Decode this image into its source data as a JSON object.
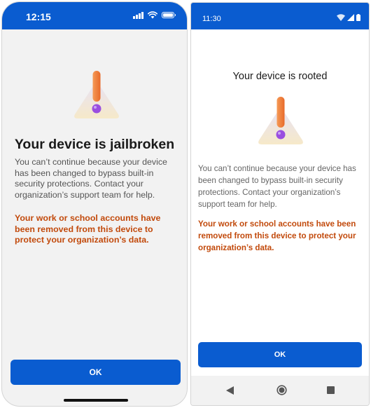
{
  "ios": {
    "status_time": "12:15",
    "status_icons": [
      "signal-icon",
      "wifi-icon",
      "battery-icon"
    ],
    "illustration": "warning-icon",
    "title": "Your device is jailbroken",
    "body": "You can’t continue because your device has been changed to bypass built-in security protections. Contact your organization’s support team for help.",
    "warning": "Your work or school accounts have been removed from this device to protect your organization’s data.",
    "ok_label": "OK"
  },
  "android": {
    "status_time": "11:30",
    "status_icons": [
      "wifi-icon",
      "signal-icon",
      "battery-icon"
    ],
    "illustration": "warning-icon",
    "title": "Your device is rooted",
    "body": "You can’t continue because your device has been changed to bypass built-in security protections. Contact your organization’s support team for help.",
    "warning": "Your work or school accounts have been removed from this device to protect your organization’s data.",
    "ok_label": "OK",
    "nav_buttons": [
      "back-icon",
      "home-icon",
      "recents-icon"
    ]
  },
  "colors": {
    "brand_blue": "#0a5cd0",
    "warning_text": "#c24a0c",
    "exclamation_orange": "#f07a3a",
    "dot_purple": "#9a4ee0"
  }
}
